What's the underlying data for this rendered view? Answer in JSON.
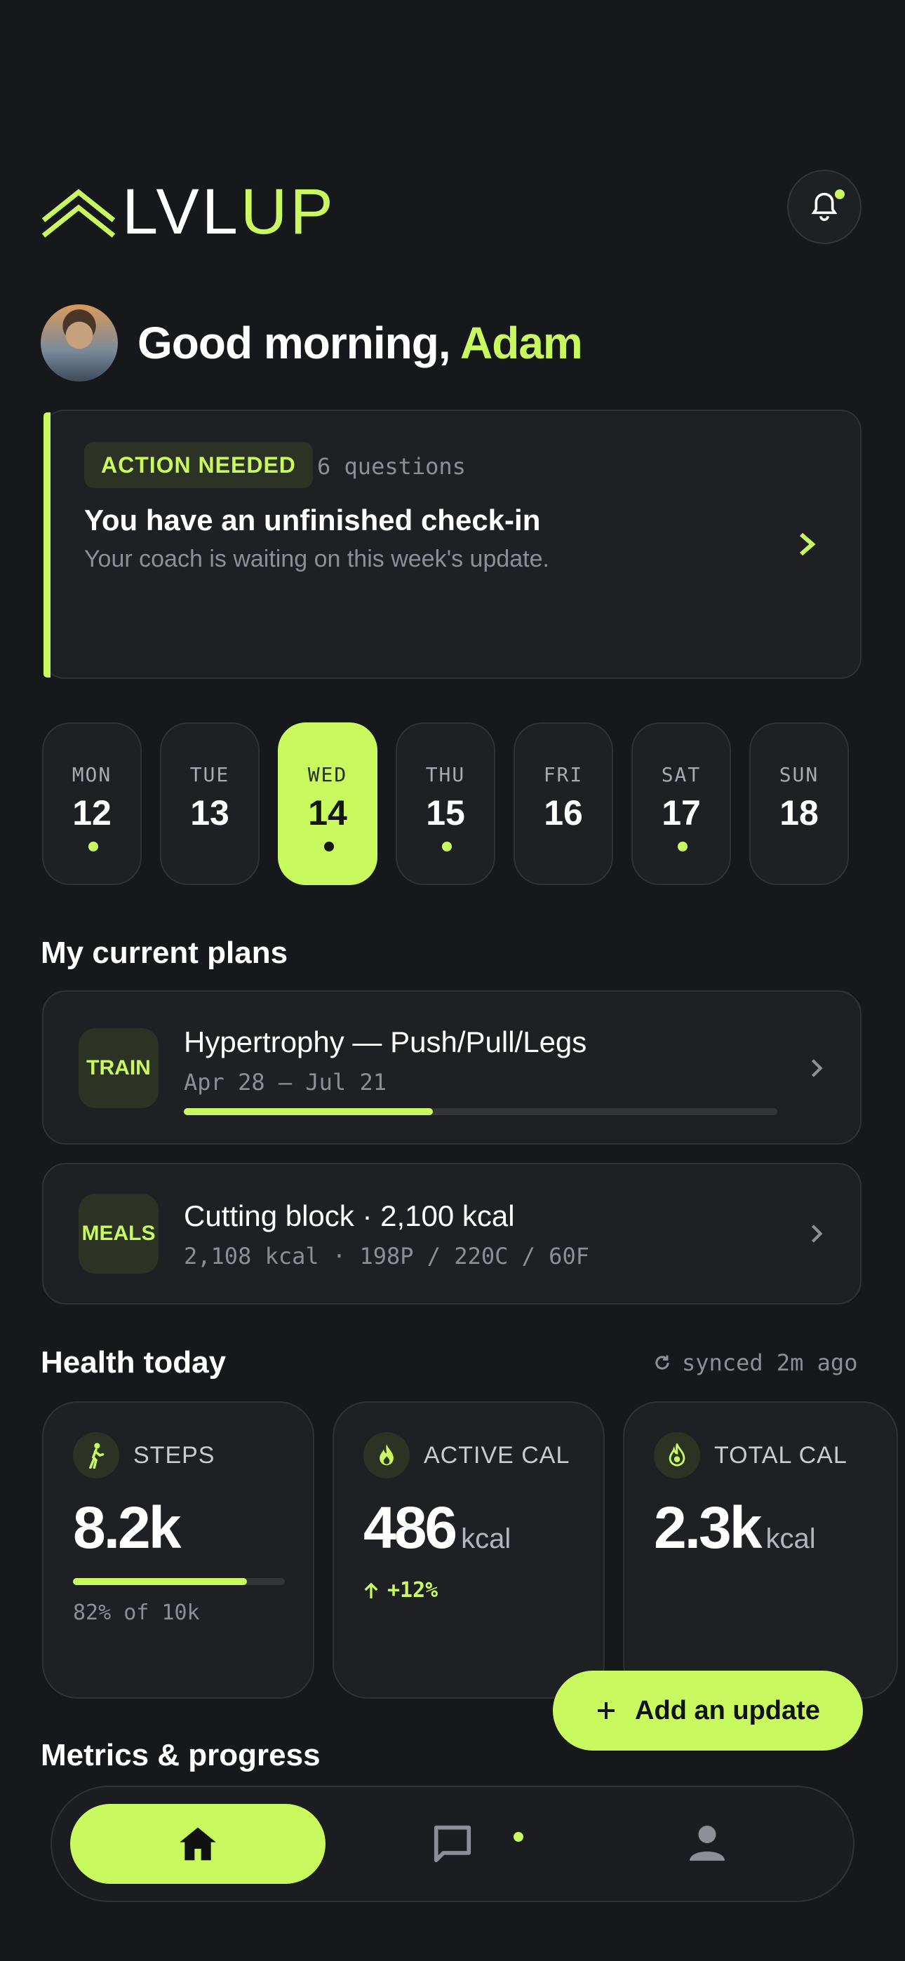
{
  "app": {
    "logo_part1": "LVL",
    "logo_part2": "UP"
  },
  "header": {
    "greeting_prefix": "Good morning,",
    "user_name": "Adam",
    "notifications_icon": "bell-icon"
  },
  "checkin": {
    "badge": "ACTION NEEDED",
    "count": "6 questions",
    "title": "You have an unfinished check-in",
    "subtitle": "Your coach is waiting on this week's update."
  },
  "week": [
    {
      "name": "MON",
      "num": "12",
      "dot": true,
      "active": false
    },
    {
      "name": "TUE",
      "num": "13",
      "dot": false,
      "active": false
    },
    {
      "name": "WED",
      "num": "14",
      "dot": true,
      "active": true
    },
    {
      "name": "THU",
      "num": "15",
      "dot": true,
      "active": false
    },
    {
      "name": "FRI",
      "num": "16",
      "dot": false,
      "active": false
    },
    {
      "name": "SAT",
      "num": "17",
      "dot": true,
      "active": false
    },
    {
      "name": "SUN",
      "num": "18",
      "dot": false,
      "active": false
    }
  ],
  "plans": {
    "title": "My current plans",
    "items": [
      {
        "tag": "TRAIN",
        "title": "Hypertrophy — Push/Pull/Legs",
        "subtitle": "Apr 28 — Jul 21",
        "progress": 0.42
      },
      {
        "tag": "MEALS",
        "title": "Cutting block · 2,100 kcal",
        "subtitle": "2,108 kcal · 198P / 220C / 60F"
      }
    ]
  },
  "health": {
    "title": "Health today",
    "synced": "synced 2m ago",
    "cards": [
      {
        "label": "STEPS",
        "value": "8.2k",
        "unit": "",
        "note": "82% of 10k",
        "progress": 0.82,
        "icon": "walk-icon"
      },
      {
        "label": "ACTIVE CAL",
        "value": "486",
        "unit": "kcal",
        "trend": "+12%",
        "icon": "flame-icon"
      },
      {
        "label": "TOTAL CAL",
        "value": "2.3k",
        "unit": "kcal",
        "icon": "fire-icon"
      }
    ]
  },
  "fab": {
    "label": "Add an update"
  },
  "metrics": {
    "title": "Metrics & progress"
  },
  "nav": {
    "items": [
      "home-icon",
      "chat-icon",
      "profile-icon"
    ]
  },
  "colors": {
    "accent": "#c8fa5f",
    "background": "#17181b",
    "card": "#1f2024"
  }
}
